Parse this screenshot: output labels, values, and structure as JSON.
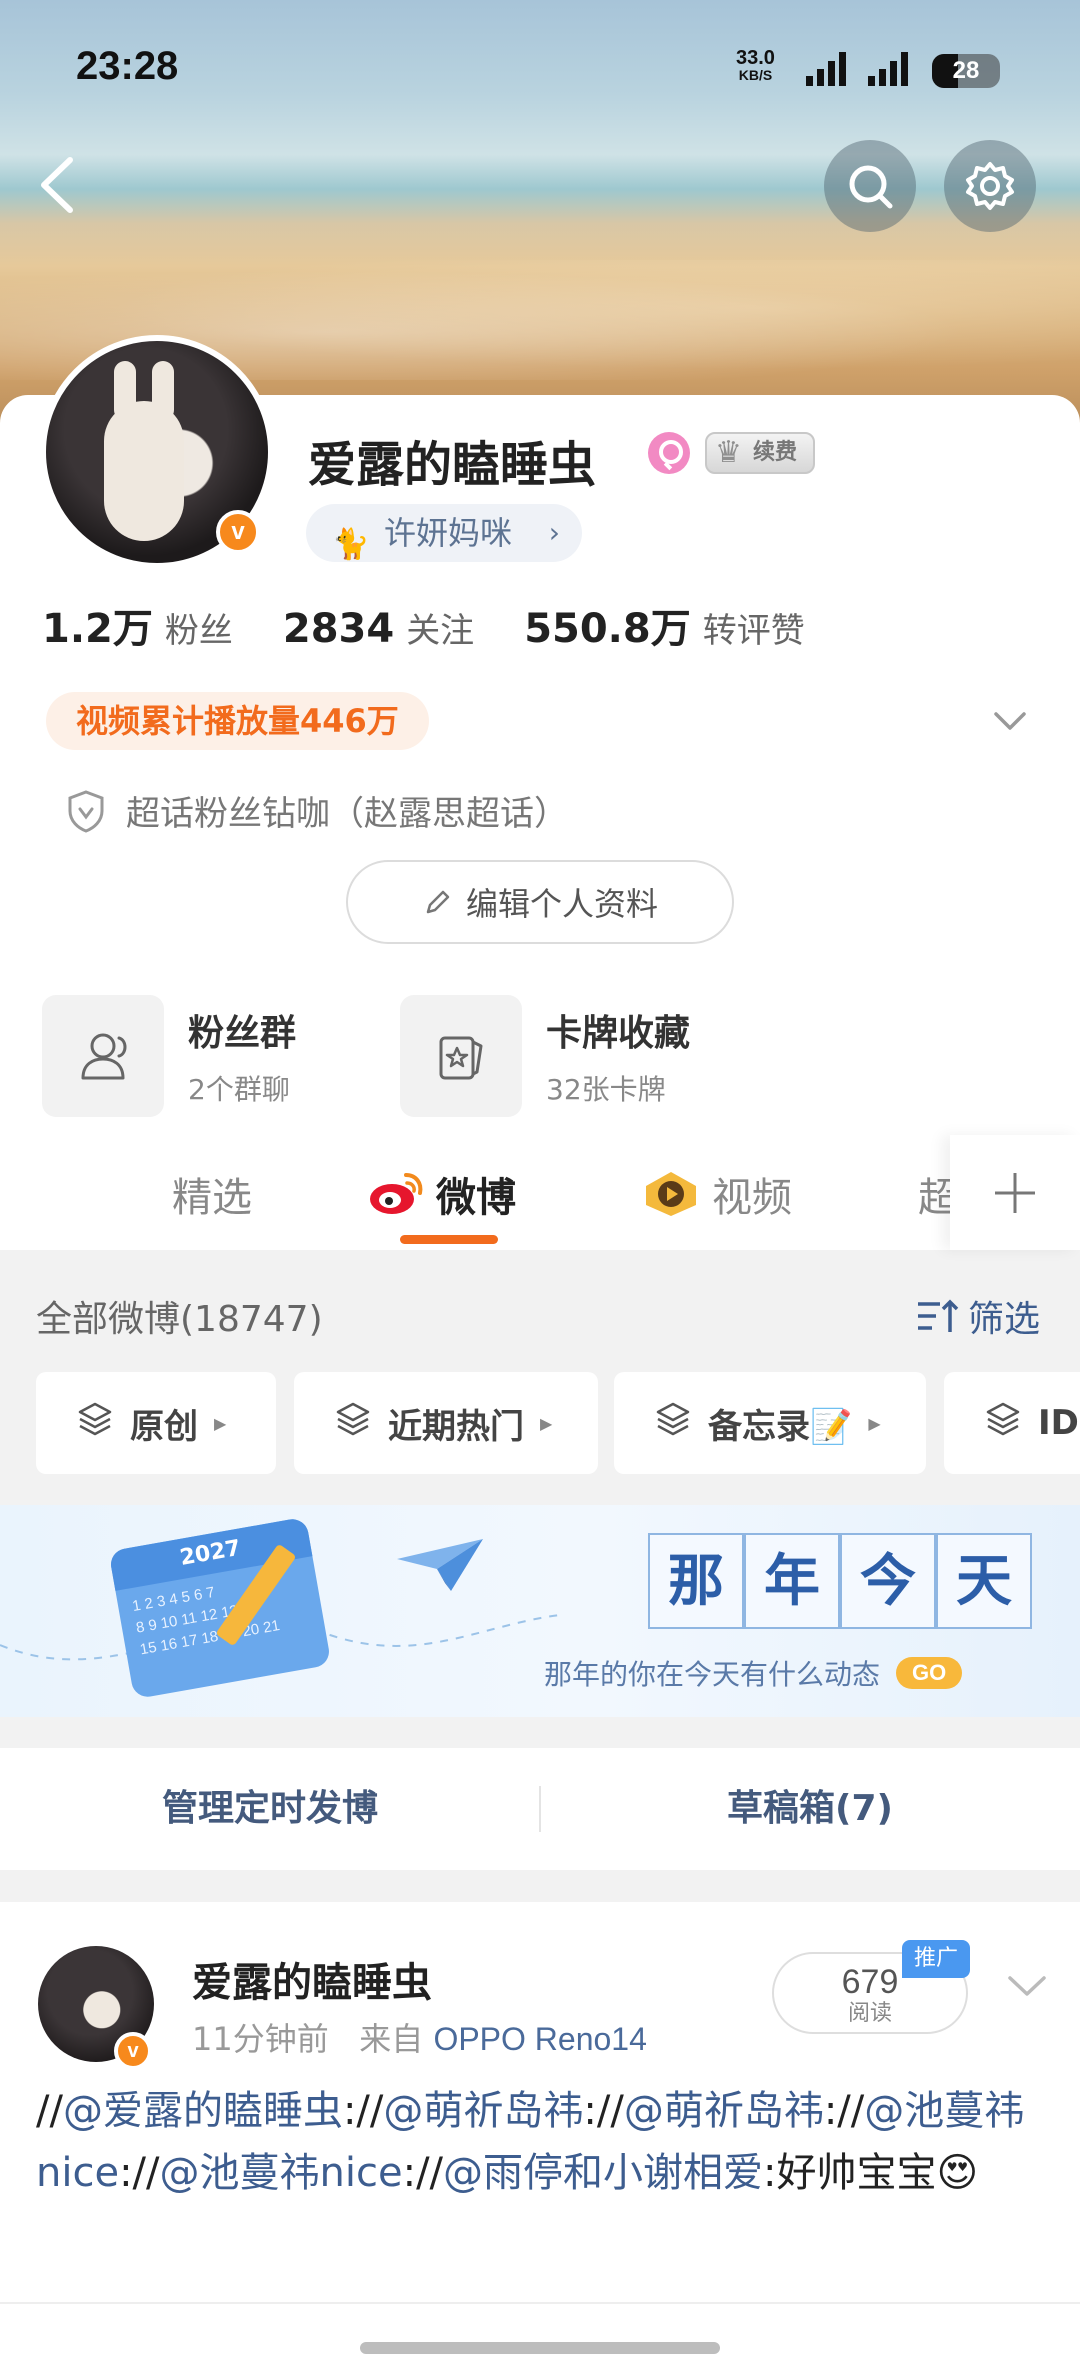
{
  "status_bar": {
    "time": "23:28",
    "net_speed": "33.0",
    "net_unit": "KB/S",
    "battery": "28"
  },
  "profile": {
    "username": "爱露的瞌睡虫",
    "vip_label": "续费",
    "relation_tag": "许妍妈咪",
    "stats": [
      {
        "num": "1.2万",
        "label": "粉丝"
      },
      {
        "num": "2834",
        "label": "关注"
      },
      {
        "num": "550.8万",
        "label": "转评赞"
      }
    ],
    "play_count": "视频累计播放量446万",
    "superchat": "超话粉丝钻咖（赵露思超话）",
    "edit_button": "编辑个人资料",
    "features": [
      {
        "title": "粉丝群",
        "sub": "2个群聊"
      },
      {
        "title": "卡牌收藏",
        "sub": "32张卡牌"
      }
    ]
  },
  "tabs": [
    "精选",
    "微博",
    "视频",
    "超"
  ],
  "filter": {
    "header": "全部微博(18747)",
    "filter_label": "筛选",
    "chips": [
      "原创",
      "近期热门",
      "备忘录📝",
      "ID"
    ]
  },
  "memory_banner": {
    "title_chars": [
      "那",
      "年",
      "今",
      "天"
    ],
    "subtitle": "那年的你在今天有什么动态",
    "go": "GO",
    "calendar_year": "2027",
    "calendar_grid": "1 2 3 4 5 6 7\n8 9 10 11 12 13 14\n15 16 17 18 19 20 21"
  },
  "manage": {
    "scheduled": "管理定时发博",
    "drafts": "草稿箱(7)"
  },
  "post": {
    "author": "爱露的瞌睡虫",
    "time": "11分钟前",
    "source_prefix": "来自",
    "device": "OPPO Reno14",
    "reads": "679",
    "reads_label": "阅读",
    "promo": "推广",
    "body": [
      {
        "t": "//",
        "m": false
      },
      {
        "t": "@爱露的瞌睡虫",
        "m": true
      },
      {
        "t": "://",
        "m": false
      },
      {
        "t": "@萌祈岛祎",
        "m": true
      },
      {
        "t": "://",
        "m": false
      },
      {
        "t": "@萌祈岛祎",
        "m": true
      },
      {
        "t": "://",
        "m": false
      },
      {
        "t": "@池蔓祎nice",
        "m": true
      },
      {
        "t": "://",
        "m": false
      },
      {
        "t": "@池蔓祎nice",
        "m": true
      },
      {
        "t": "://",
        "m": false
      },
      {
        "t": "@雨停和小谢相爱",
        "m": true
      },
      {
        "t": ":好帅宝宝😍",
        "m": false
      }
    ]
  },
  "colors": {
    "accent": "#f26b1d",
    "link": "#3d5d8f",
    "vip_orange": "#f7891c"
  }
}
